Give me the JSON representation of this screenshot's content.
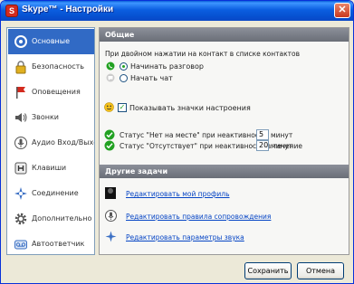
{
  "window": {
    "title": "Skype™ - Настройки",
    "app_icon_letter": "S",
    "close_glyph": "✕"
  },
  "sidebar": {
    "items": [
      {
        "label": "Основные",
        "icon": "skype-icon",
        "selected": true
      },
      {
        "label": "Безопасность",
        "icon": "lock-icon"
      },
      {
        "label": "Оповещения",
        "icon": "flag-icon"
      },
      {
        "label": "Звонки",
        "icon": "speaker-icon"
      },
      {
        "label": "Аудио Вход/Выхо",
        "icon": "audio-icon"
      },
      {
        "label": "Клавиши",
        "icon": "hotkey-icon"
      },
      {
        "label": "Соединение",
        "icon": "connection-icon"
      },
      {
        "label": "Дополнительно",
        "icon": "gear-icon"
      },
      {
        "label": "Автоответчик",
        "icon": "voicemail-icon"
      }
    ]
  },
  "general": {
    "header": "Общие",
    "dblclick_prompt": "При двойном нажатии на контакт в списке контактов",
    "radio_start_call": "Начинать разговор",
    "radio_start_chat": "Начать чат",
    "show_emoticons": "Показывать значки настроения",
    "away_text_1": "Статус \"Нет на месте\" при неактивности",
    "away_value": "5",
    "away_text_2": "минут",
    "na_text_1": "Статус \"Отсутствует\" при неактивности в течение",
    "na_value": "20",
    "na_text_2": "минут"
  },
  "other_tasks": {
    "header": "Другие задачи",
    "links": [
      {
        "label": "Редактировать мой профиль",
        "icon": "profile-icon"
      },
      {
        "label": "Редактировать правила сопровождения",
        "icon": "sound-icon"
      },
      {
        "label": "Редактировать параметры звука",
        "icon": "settings-icon"
      }
    ]
  },
  "buttons": {
    "save": "Сохранить",
    "cancel": "Отмена"
  },
  "colors": {
    "selection": "#316ac5",
    "titlebar": "#0a5fd8",
    "link": "#0645c5",
    "skype_green": "#21a121"
  }
}
